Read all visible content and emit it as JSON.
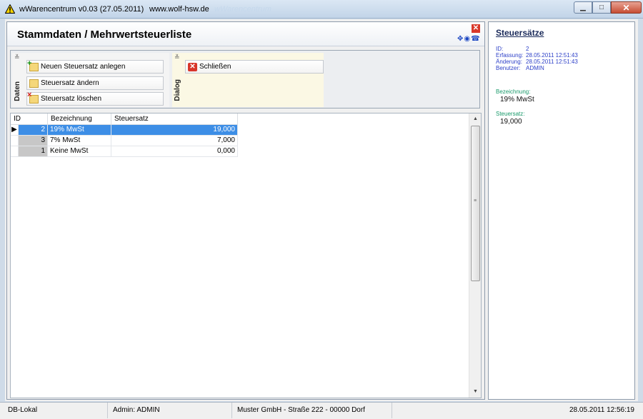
{
  "window": {
    "title": "wWarencentrum v0.03 (27.05.2011)",
    "url": "www.wolf-hsw.de",
    "ghost_title": "wWarencentrum"
  },
  "page": {
    "title": "Stammdaten / Mehrwertsteuerliste"
  },
  "ribbon": {
    "groups": [
      {
        "label": "Daten",
        "buttons": [
          "Neuen Steuersatz anlegen",
          "Steuersatz ändern",
          "Steuersatz löschen"
        ]
      },
      {
        "label": "Dialog",
        "buttons": [
          "Schließen"
        ]
      }
    ]
  },
  "grid": {
    "columns": [
      "ID",
      "Bezeichnung",
      "Steuersatz"
    ],
    "rows": [
      {
        "id": "2",
        "bezeichnung": "19% MwSt",
        "steuersatz": "19,000",
        "selected": true
      },
      {
        "id": "3",
        "bezeichnung": "7% MwSt",
        "steuersatz": "7,000",
        "selected": false
      },
      {
        "id": "1",
        "bezeichnung": "Keine MwSt",
        "steuersatz": "0,000",
        "selected": false
      }
    ]
  },
  "detail": {
    "title": "Steuersätze",
    "meta": [
      {
        "key": "ID:",
        "value": "2"
      },
      {
        "key": "Erfassung:",
        "value": "28.05.2011 12:51:43"
      },
      {
        "key": "Änderung:",
        "value": "28.05.2011 12:51:43"
      },
      {
        "key": "Benutzer:",
        "value": "ADMIN"
      }
    ],
    "bezeichnung_label": "Bezeichnung:",
    "bezeichnung_value": "19% MwSt",
    "steuersatz_label": "Steuersatz:",
    "steuersatz_value": "19,000"
  },
  "status": {
    "db": "DB-Lokal",
    "user": "Admin: ADMIN",
    "company": "Muster GmbH  -  Straße 222  -  00000 Dorf",
    "datetime": "28.05.2011 12:56:19"
  },
  "colors": {
    "selection": "#3d8ee6",
    "accent_green": "#1a9a6b",
    "meta_blue": "#2c3fc8"
  },
  "icons": {
    "app": "warning-triangle-icon",
    "close_red": "close-icon",
    "new_folder": "folder-add-icon",
    "edit_folder": "folder-icon",
    "delete_folder": "folder-delete-icon",
    "row_pointer": "row-pointer-icon"
  }
}
